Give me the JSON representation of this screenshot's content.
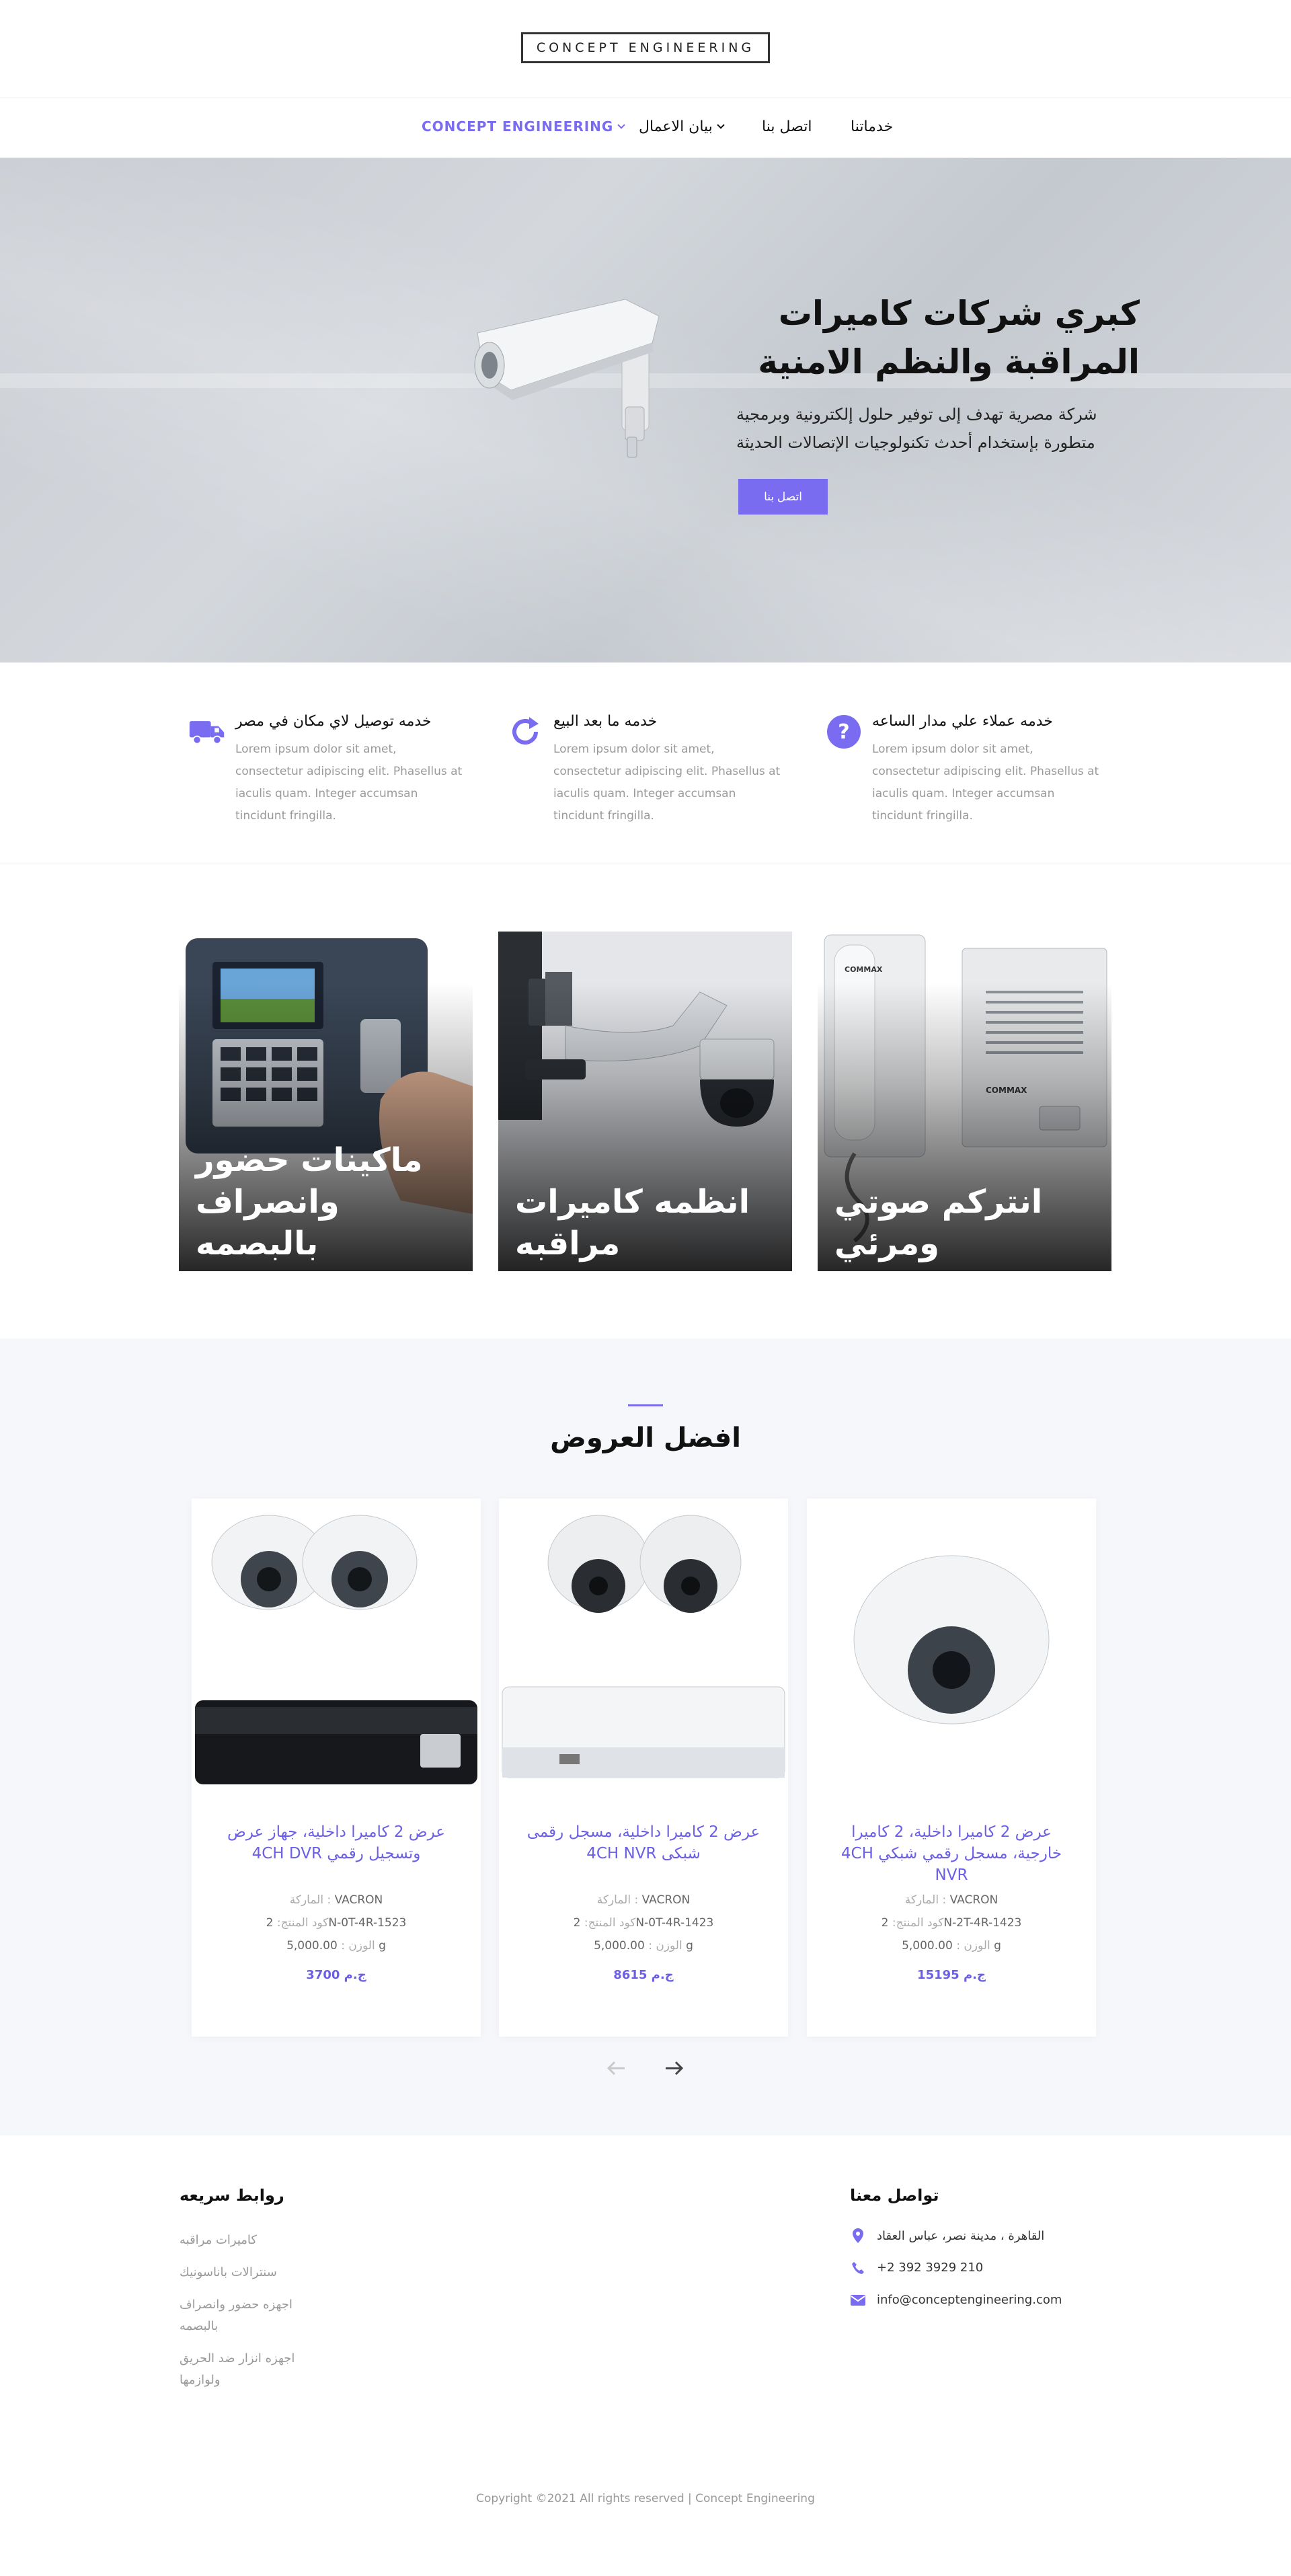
{
  "brand": {
    "logo_text": "CONCEPT ENGINEERING",
    "accent": "#7a6cf0"
  },
  "nav": {
    "items": [
      {
        "label": "CONCEPT ENGINEERING",
        "has_dropdown": true,
        "active": true
      },
      {
        "label": "بيان الاعمال",
        "has_dropdown": true
      },
      {
        "label": "اتصل بنا",
        "has_dropdown": false
      },
      {
        "label": "خدماتنا",
        "has_dropdown": false
      }
    ]
  },
  "hero": {
    "title": "كبري شركات كاميرات المراقبة والنظم الامنية",
    "subtitle": "شركة مصرية تهدف إلى توفير حلول إلكترونية وبرمجية متطورة بإستخدام أحدث تكنولوجيات الإتصالات الحديثة",
    "button": "اتصل بنا"
  },
  "features": [
    {
      "icon": "truck-icon",
      "title": "خدمه توصيل لاي مكان في مصر",
      "text": "Lorem ipsum dolor sit amet, consectetur adipiscing elit. Phasellus at iaculis quam. Integer accumsan tincidunt fringilla."
    },
    {
      "icon": "refresh-icon",
      "title": "خدمه ما بعد البيع",
      "text": "Lorem ipsum dolor sit amet, consectetur adipiscing elit. Phasellus at iaculis quam. Integer accumsan tincidunt fringilla."
    },
    {
      "icon": "question-icon",
      "title": "خدمه عملاء علي مدار الساعه",
      "text": "Lorem ipsum dolor sit amet, consectetur adipiscing elit. Phasellus at iaculis quam. Integer accumsan tincidunt fringilla."
    }
  ],
  "categories": [
    {
      "label": "ماكينات حضور وانصراف بالبصمه"
    },
    {
      "label": "انظمه كاميرات مراقبه"
    },
    {
      "label": "انتركم صوتي ومرئي"
    }
  ],
  "offers": {
    "title": "افضل العروض",
    "meta_labels": {
      "brand": "الماركة :",
      "code": "كود المنتج:",
      "weight": "الوزن :"
    },
    "products": [
      {
        "title": "عرض 2 كاميرا داخلية، جهاز عرض وتسجيل رقمي 4CH DVR",
        "brand": "VACRON",
        "code": "2N-0T-4R-1523",
        "weight": "5,000.00 g",
        "price": "3700 ج.م"
      },
      {
        "title": "عرض 2 كاميرا داخلية، مسجل رقمى شبكى 4CH NVR",
        "brand": "VACRON",
        "code": "2N-0T-4R-1423",
        "weight": "5,000.00 g",
        "price": "8615 ج.م"
      },
      {
        "title": "عرض 2 كاميرا داخلية، 2 كاميرا خارجية، مسجل رقمي شبكي 4CH NVR",
        "brand": "VACRON",
        "code": "2N-2T-4R-1423",
        "weight": "5,000.00 g",
        "price": "15195 ج.م"
      }
    ]
  },
  "footer": {
    "quick_links_title": "روابط سريعه",
    "quick_links": [
      "كاميرات مراقبه",
      "سنترالات باناسونيك",
      "اجهزه حضور وانصراف بالبصمه",
      "اجهزه انزار ضد الحريق ولوازمها"
    ],
    "contact_title": "تواصل معنا",
    "address": "القاهرة ، مدينة نصر، عباس العقاد",
    "phone": "+2 392 3929 210",
    "email": "info@conceptengineering.com",
    "copyright": "Copyright ©2021 All rights reserved | Concept Engineering"
  }
}
